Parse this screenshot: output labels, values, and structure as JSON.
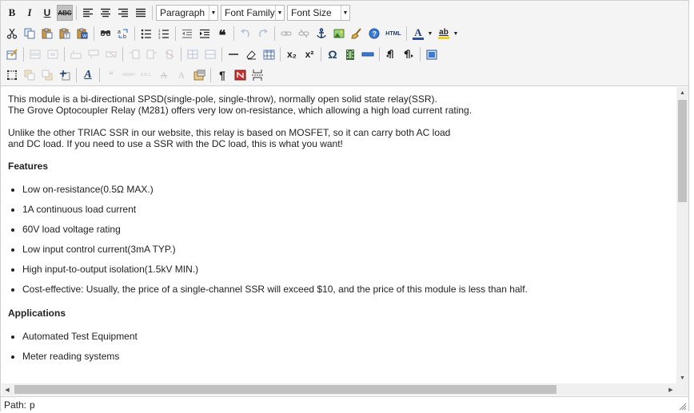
{
  "toolbar": {
    "format_select": "Paragraph",
    "font_family_select": "Font Family",
    "font_size_select": "Font Size",
    "bold_label": "B",
    "italic_label": "I",
    "underline_label": "U",
    "strike_label": "ABC",
    "html_label": "HTML",
    "subscript_label": "x₂",
    "superscript_label": "x²",
    "omega_label": "Ω",
    "pilcrow_label": "¶",
    "textcolor_label": "A",
    "bgcolor_label": "ab",
    "quote_label": "❝",
    "styleprops_label": "A",
    "cite_label": "“",
    "abbr_label": "ABBR",
    "acronym_label": "A.B.C.",
    "del_label": "A",
    "ins_label": "A"
  },
  "colors": {
    "toolbar_bg": "#f4f4f4",
    "text_color_swatch": "#2b4ea1",
    "bg_color_swatch": "#f0d020",
    "accent_blue": "#1f5fbf"
  },
  "content": {
    "para1_line1": "This module is a bi-directional SPSD(single-pole, single-throw), normally open solid state relay(SSR).",
    "para1_line2": "The Grove Optocoupler Relay (M281) offers very low on-resistance, which allowing a high load current rating.",
    "para2_line1": "Unlike the other TRIAC SSR in our website, this relay is based on MOSFET, so it can carry both AC load",
    "para2_line2": "and DC load. If you need to use a SSR with the DC load, this is what you want!",
    "features_heading": "Features",
    "features": [
      "Low on-resistance(0.5Ω MAX.)",
      "1A continuous load current",
      "60V load voltage rating",
      "Low input control current(3mA TYP.)",
      "High input-to-output isolation(1.5kV MIN.)",
      "Cost-effective: Usually, the price of a single-channel SSR will exceed $10, and the price of this module is less than half."
    ],
    "applications_heading": "Applications",
    "applications": [
      "Automated Test Equipment",
      "Meter reading systems"
    ]
  },
  "status": {
    "path_label": "Path:",
    "path_value": "p"
  },
  "icons": [
    "cut-icon",
    "copy-icon",
    "paste-icon",
    "paste-text-icon",
    "paste-word-icon",
    "find-icon",
    "replace-icon",
    "bullet-list-icon",
    "numbered-list-icon",
    "outdent-icon",
    "indent-icon",
    "blockquote-icon",
    "undo-icon",
    "redo-icon",
    "link-icon",
    "unlink-icon",
    "anchor-icon",
    "image-icon",
    "cleanup-icon",
    "help-icon",
    "html-icon",
    "text-color-icon",
    "bg-color-icon"
  ]
}
